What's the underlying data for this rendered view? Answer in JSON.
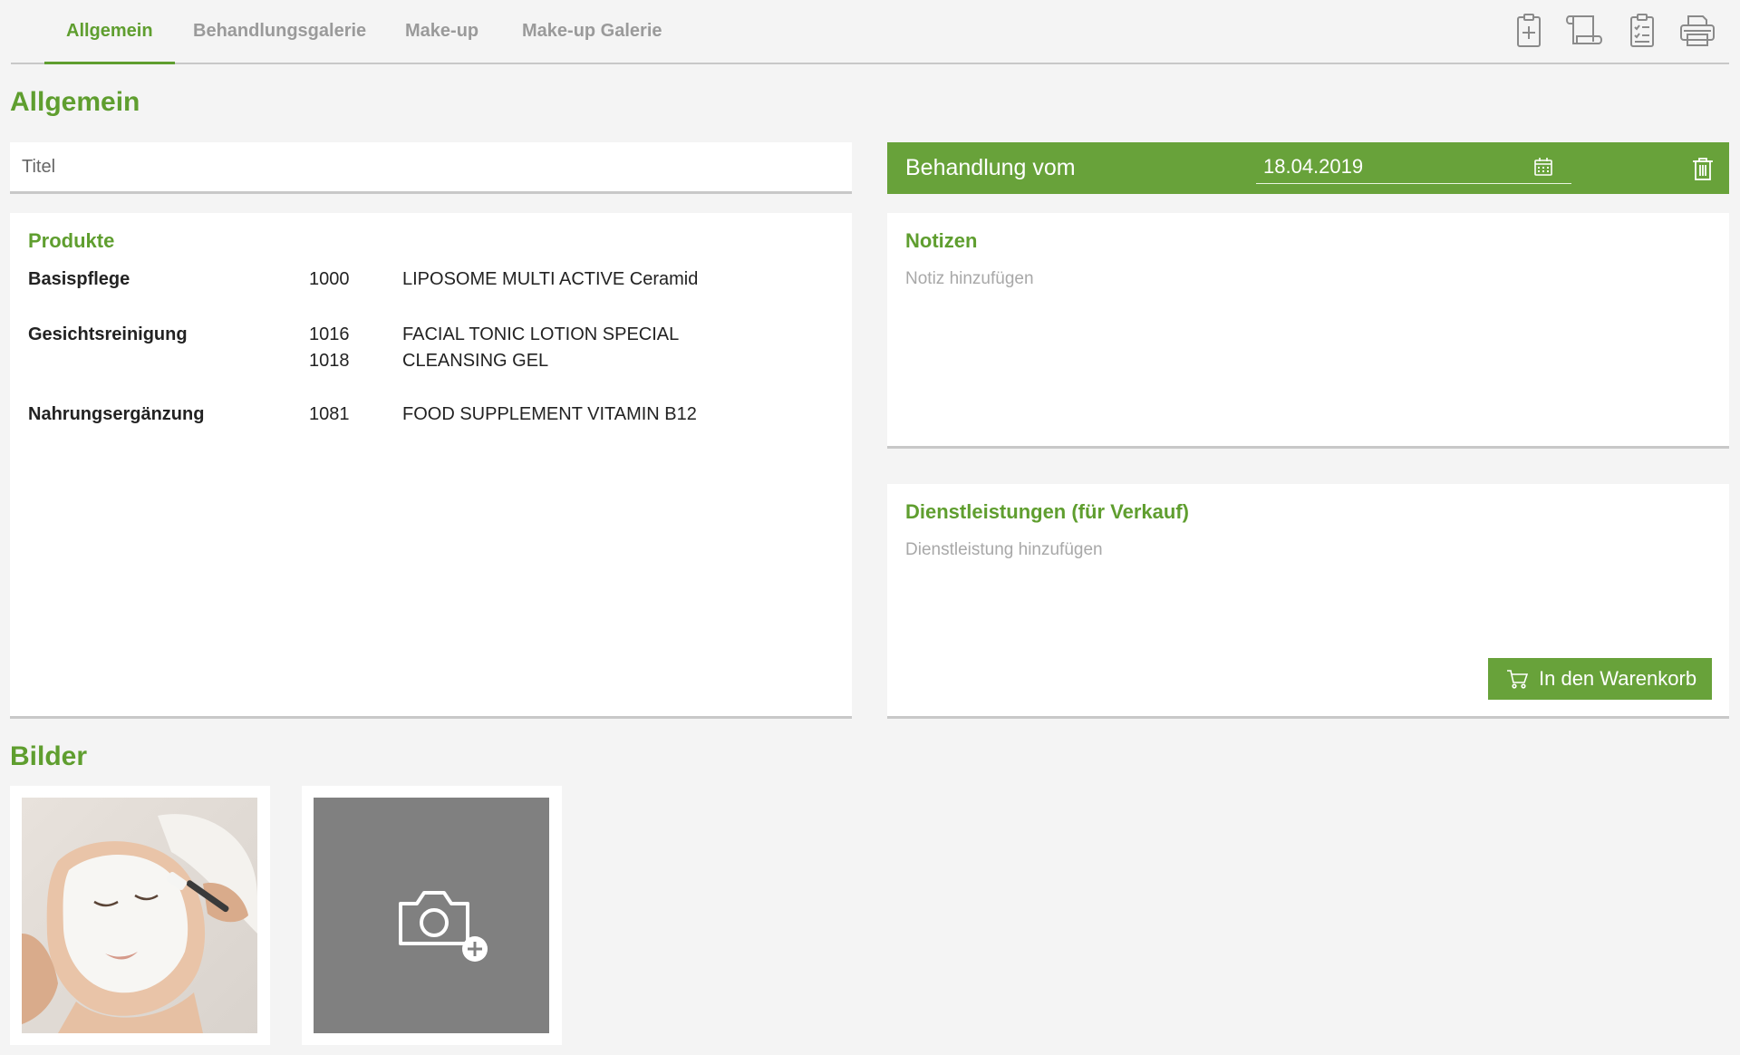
{
  "tabs": [
    {
      "label": "Allgemein",
      "active": true
    },
    {
      "label": "Behandlungsgalerie",
      "active": false
    },
    {
      "label": "Make-up",
      "active": false
    },
    {
      "label": "Make-up Galerie",
      "active": false
    }
  ],
  "toolbar_icons": [
    "clipboard-plus-icon",
    "scroll-icon",
    "clipboard-list-icon",
    "printer-icon"
  ],
  "page_title": "Allgemein",
  "titel": {
    "placeholder": "Titel",
    "value": ""
  },
  "behandlung": {
    "label": "Behandlung vom",
    "date": "18.04.2019"
  },
  "produkte": {
    "title": "Produkte",
    "groups": [
      {
        "category": "Basispflege",
        "items": [
          {
            "number": "1000",
            "name": "LIPOSOME MULTI ACTIVE Ceramid"
          }
        ]
      },
      {
        "category": "Gesichtsreinigung",
        "items": [
          {
            "number": "1016",
            "name": "FACIAL TONIC LOTION SPECIAL"
          },
          {
            "number": "1018",
            "name": "CLEANSING GEL"
          }
        ]
      },
      {
        "category": "Nahrungsergänzung",
        "items": [
          {
            "number": "1081",
            "name": "FOOD SUPPLEMENT VITAMIN B12"
          }
        ]
      }
    ]
  },
  "notizen": {
    "title": "Notizen",
    "placeholder": "Notiz hinzufügen"
  },
  "dienstleistungen": {
    "title": "Dienstleistungen (für Verkauf)",
    "placeholder": "Dienstleistung hinzufügen",
    "cart_button": "In den Warenkorb"
  },
  "bilder": {
    "title": "Bilder"
  },
  "colors": {
    "accent": "#68a23a",
    "accent_text": "#5f9e2f",
    "background": "#f4f4f4",
    "muted": "#9a9a9a"
  }
}
